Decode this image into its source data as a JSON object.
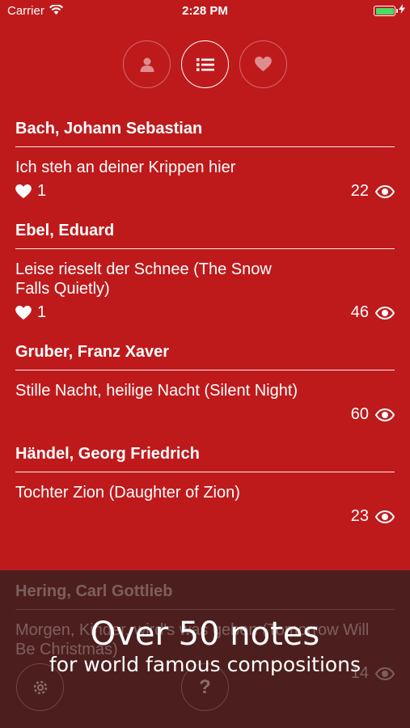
{
  "status_bar": {
    "carrier": "Carrier",
    "time": "2:28 PM"
  },
  "tabs": [
    {
      "icon": "person-icon",
      "active": false
    },
    {
      "icon": "list-icon",
      "active": true
    },
    {
      "icon": "heart-icon",
      "active": false
    }
  ],
  "entries": [
    {
      "composer": "Bach, Johann Sebastian",
      "title": "Ich steh an deiner Krippen hier",
      "likes": "1",
      "views": "22"
    },
    {
      "composer": "Ebel, Eduard",
      "title": "Leise rieselt der Schnee (The Snow Falls Quietly)",
      "likes": "1",
      "views": "46"
    },
    {
      "composer": "Gruber, Franz Xaver",
      "title": "Stille Nacht, heilige Nacht (Silent Night)",
      "likes": null,
      "views": "60"
    },
    {
      "composer": "Händel, Georg Friedrich",
      "title": "Tochter Zion (Daughter of Zion)",
      "likes": null,
      "views": "23"
    }
  ],
  "ghost_entry": {
    "composer": "Hering, Carl Gottlieb",
    "title": "Morgen, Kinder, wird's was geben (Tomorrow Will Be Christmas)",
    "views": "14"
  },
  "ghost_tabs": [
    {
      "icon": "gear-icon"
    },
    {
      "icon": "help-icon",
      "label": "?"
    }
  ],
  "promo": {
    "title": "Over 50 notes",
    "subtitle": "for world famous compositions"
  },
  "colors": {
    "background": "#be1a1c",
    "overlay": "#42201e",
    "battery": "#4cd964"
  }
}
